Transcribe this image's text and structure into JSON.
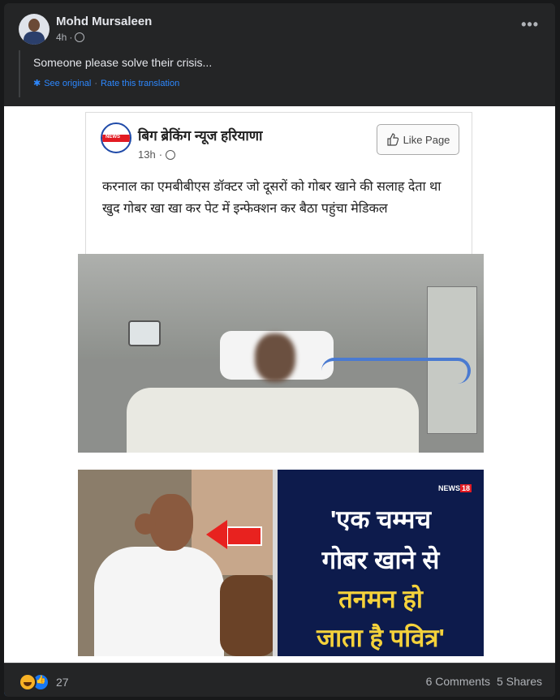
{
  "post": {
    "author": "Mohd Mursaleen",
    "time": "4h",
    "text": "Someone please solve their crisis...",
    "see_original": "See original",
    "rate_translation": "Rate this translation",
    "separator": "·"
  },
  "shared_post": {
    "page_name": "बिग ब्रेकिंग न्यूज हरियाणा",
    "time": "13h",
    "like_page_label": "Like Page",
    "text": "करनाल का एमबीबीएस डॉक्टर जो दूसरों को गोबर खाने की सलाह देता था खुद गोबर खा खा कर पेट में इन्फेक्शन कर बैठा पहुंचा मेडिकल"
  },
  "news_graphic": {
    "channel": "NEWS",
    "channel_num": "18",
    "line1": "'एक चम्मच",
    "line2": "गोबर खाने से",
    "line3": "तनमन हो",
    "line4": "जाता है पवित्र'"
  },
  "footer": {
    "reaction_count": "27",
    "comments": "6 Comments",
    "shares": "5 Shares"
  },
  "icons": {
    "globe": "globe-icon",
    "gear": "gear-icon",
    "more": "more-icon",
    "thumb": "thumb-up-icon",
    "haha": "haha-reaction-icon",
    "like": "like-reaction-icon"
  },
  "colors": {
    "background": "#18191a",
    "card": "#242526",
    "link": "#2d88ff",
    "news_yellow": "#f5d23b",
    "news_red": "#e21b23"
  }
}
